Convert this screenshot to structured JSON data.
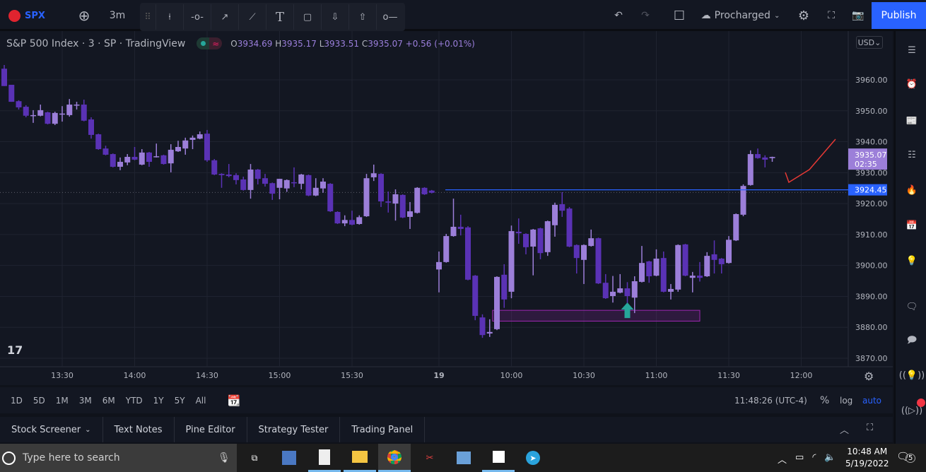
{
  "header": {
    "symbol": "SPX",
    "interval": "3m",
    "layout_name": "Procharged",
    "publish_label": "Publish",
    "drawing_tools": [
      "vertical-line",
      "horizontal-ray",
      "trend-arrow",
      "trend-line",
      "text",
      "rectangle",
      "arrow-down",
      "arrow-up",
      "horizontal-ray-short"
    ]
  },
  "legend": {
    "title": "S&P 500 Index · 3 · SP · TradingView",
    "open_label": "O",
    "open": "3934.69",
    "high_label": "H",
    "high": "3935.17",
    "low_label": "L",
    "low": "3933.51",
    "close_label": "C",
    "close": "3935.07",
    "change": "+0.56 (+0.01%)"
  },
  "price_scale": {
    "currency": "USD",
    "last_price": "3935.07",
    "countdown": "02:35",
    "hline_price": "3924.45"
  },
  "colors": {
    "up": "#9c7fd9",
    "down": "#5a32b5",
    "hline": "#2962ff",
    "box": "#9c27b0",
    "arrow": "#26a69a",
    "drawing": "#e53935",
    "accent": "#2962ff"
  },
  "chart_data": {
    "type": "candlestick",
    "ylim": [
      3865,
      3972
    ],
    "y_ticks": [
      3870,
      3880,
      3890,
      3900,
      3910,
      3920,
      3930,
      3940,
      3950,
      3960
    ],
    "x_ticks": [
      {
        "label": "13:30",
        "bar": 8
      },
      {
        "label": "14:00",
        "bar": 18
      },
      {
        "label": "14:30",
        "bar": 28
      },
      {
        "label": "15:00",
        "bar": 38
      },
      {
        "label": "15:30",
        "bar": 48
      },
      {
        "label": "19",
        "bar": 60
      },
      {
        "label": "10:00",
        "bar": 70
      },
      {
        "label": "10:30",
        "bar": 80
      },
      {
        "label": "11:00",
        "bar": 90
      },
      {
        "label": "11:30",
        "bar": 100
      },
      {
        "label": "12:00",
        "bar": 110
      }
    ],
    "candles_ohlc": [
      [
        3963.6,
        3964.8,
        3958,
        3958
      ],
      [
        3958.4,
        3958.4,
        3952.9,
        3952.9
      ],
      [
        3953.1,
        3953.4,
        3950.4,
        3951.1
      ],
      [
        3951.3,
        3951.8,
        3947.9,
        3948.4
      ],
      [
        3948.6,
        3950.2,
        3946.1,
        3948.6
      ],
      [
        3948.4,
        3952,
        3948.2,
        3950.2
      ],
      [
        3949.5,
        3949.7,
        3945.6,
        3945.8
      ],
      [
        3945.8,
        3949.7,
        3945.4,
        3949.3
      ],
      [
        3949,
        3951.5,
        3946.5,
        3949.1
      ],
      [
        3948.6,
        3953.8,
        3948.1,
        3952
      ],
      [
        3951.8,
        3952.9,
        3950.4,
        3952
      ],
      [
        3952,
        3953.6,
        3946.6,
        3946.8
      ],
      [
        3947.2,
        3947.9,
        3941,
        3942.2
      ],
      [
        3942.4,
        3942.6,
        3937.4,
        3937.6
      ],
      [
        3937.8,
        3938.7,
        3935.6,
        3935.8
      ],
      [
        3936,
        3936.2,
        3931.7,
        3931.9
      ],
      [
        3931.9,
        3934.9,
        3930.8,
        3933.5
      ],
      [
        3933.3,
        3936,
        3932.4,
        3935.1
      ],
      [
        3935.1,
        3938.3,
        3934,
        3934.2
      ],
      [
        3932.6,
        3937.6,
        3932.4,
        3936.5
      ],
      [
        3936.5,
        3936.7,
        3931.9,
        3933.5
      ],
      [
        3935.1,
        3939.4,
        3934.9,
        3935.3
      ],
      [
        3935.6,
        3935.8,
        3932.6,
        3932.8
      ],
      [
        3933,
        3939.2,
        3930.1,
        3937.4
      ],
      [
        3936.9,
        3940.3,
        3936.7,
        3938.3
      ],
      [
        3937.8,
        3941.3,
        3935.8,
        3940.4
      ],
      [
        3940.6,
        3942,
        3937.6,
        3941.3
      ],
      [
        3941,
        3943.3,
        3940.8,
        3942.4
      ],
      [
        3942.6,
        3943.8,
        3933.5,
        3934
      ],
      [
        3934,
        3934.4,
        3929.2,
        3929.4
      ],
      [
        3929.6,
        3929.8,
        3925.1,
        3929.2
      ],
      [
        3929.4,
        3932.8,
        3928.5,
        3928.9
      ],
      [
        3929.2,
        3929.8,
        3926.2,
        3927.6
      ],
      [
        3927.8,
        3928.7,
        3924.2,
        3924.4
      ],
      [
        3924.4,
        3932.8,
        3921.6,
        3931
      ],
      [
        3931,
        3931.2,
        3926.2,
        3928
      ],
      [
        3928.2,
        3929.6,
        3925.5,
        3926.4
      ],
      [
        3926.6,
        3926.8,
        3921.2,
        3923.2
      ],
      [
        3925.1,
        3928,
        3921.4,
        3928
      ],
      [
        3924.9,
        3927.8,
        3923.8,
        3927.6
      ],
      [
        3926.9,
        3931.7,
        3925.3,
        3926.6
      ],
      [
        3926.4,
        3929.6,
        3924.6,
        3929.4
      ],
      [
        3929.2,
        3929.4,
        3922.4,
        3922.6
      ],
      [
        3922.6,
        3928.2,
        3922.4,
        3925.1
      ],
      [
        3924.9,
        3928.2,
        3923.5,
        3927.1
      ],
      [
        3926.4,
        3926.6,
        3917.3,
        3917.5
      ],
      [
        3917.3,
        3917.5,
        3913.4,
        3913.6
      ],
      [
        3913.6,
        3916.2,
        3912.7,
        3914.7
      ],
      [
        3914.7,
        3917.7,
        3913,
        3913.2
      ],
      [
        3913.4,
        3916.2,
        3913.2,
        3915.6
      ],
      [
        3915.9,
        3929.6,
        3915.7,
        3928.2
      ],
      [
        3928.5,
        3932.6,
        3927.3,
        3929.8
      ],
      [
        3929.6,
        3929.8,
        3918.9,
        3920.7
      ],
      [
        3920.7,
        3923.9,
        3917.1,
        3920.3
      ],
      [
        3920,
        3924.6,
        3914.5,
        3923
      ],
      [
        3922.8,
        3923,
        3915.3,
        3915.5
      ],
      [
        3915.7,
        3920.5,
        3911.8,
        3917.5
      ],
      [
        3917,
        3925.3,
        3916.8,
        3925.1
      ],
      [
        3925.1,
        3925.3,
        3922.8,
        3923
      ],
      [
        3924.2,
        3924.4,
        3923.3,
        3923.5
      ],
      [
        3898.7,
        3904.5,
        3891.3,
        3901.1
      ],
      [
        3901.1,
        3910.2,
        3900.9,
        3909.5
      ],
      [
        3909.5,
        3921.6,
        3909.3,
        3912.5
      ],
      [
        3912.5,
        3916.4,
        3909.7,
        3911.8
      ],
      [
        3912.3,
        3912.7,
        3895.2,
        3895.4
      ],
      [
        3896.7,
        3896.9,
        3882.3,
        3883.7
      ],
      [
        3883.2,
        3884.2,
        3876.6,
        3877.5
      ],
      [
        3878,
        3882.6,
        3876.9,
        3878.5
      ],
      [
        3879.4,
        3896.5,
        3879.1,
        3896.3
      ],
      [
        3897,
        3900.4,
        3886.3,
        3889
      ],
      [
        3891.5,
        3912.9,
        3889.4,
        3911.1
      ],
      [
        3910.9,
        3915.2,
        3907,
        3910.4
      ],
      [
        3910.2,
        3910.4,
        3903.6,
        3905.9
      ],
      [
        3906.1,
        3911.8,
        3896.8,
        3911.6
      ],
      [
        3912,
        3912.2,
        3902,
        3904
      ],
      [
        3904.3,
        3914.5,
        3903.1,
        3914.3
      ],
      [
        3913,
        3920.3,
        3909.3,
        3919.6
      ],
      [
        3919.8,
        3923.7,
        3915.7,
        3917.7
      ],
      [
        3918.4,
        3918.9,
        3905.9,
        3906.1
      ],
      [
        3906.6,
        3906.8,
        3897.4,
        3902.4
      ],
      [
        3901.8,
        3906.8,
        3894,
        3906.6
      ],
      [
        3906.3,
        3911.6,
        3906.1,
        3908.8
      ],
      [
        3908.8,
        3909,
        3894,
        3894.2
      ],
      [
        3894.4,
        3897.2,
        3889.2,
        3889.4
      ],
      [
        3890.1,
        3896.6,
        3888,
        3891.5
      ],
      [
        3891.2,
        3897.2,
        3891,
        3892.6
      ],
      [
        3892.6,
        3894.6,
        3885.3,
        3890.1
      ],
      [
        3889.6,
        3896.5,
        3884.6,
        3894.9
      ],
      [
        3894.7,
        3906.3,
        3894.5,
        3900.8
      ],
      [
        3901.3,
        3901.5,
        3894.4,
        3896.5
      ],
      [
        3896.7,
        3905.2,
        3896.5,
        3902.2
      ],
      [
        3902.4,
        3904.5,
        3891.3,
        3891.5
      ],
      [
        3891.5,
        3894,
        3889,
        3892.4
      ],
      [
        3892.2,
        3906.8,
        3891.5,
        3906.6
      ],
      [
        3906.8,
        3907,
        3896.5,
        3896.7
      ],
      [
        3896,
        3897.9,
        3891.3,
        3896.7
      ],
      [
        3896.7,
        3901.1,
        3894.8,
        3896
      ],
      [
        3896.5,
        3904.3,
        3896.3,
        3903.1
      ],
      [
        3903.6,
        3908.1,
        3897.4,
        3901.8
      ],
      [
        3902.2,
        3902.4,
        3897.4,
        3900.4
      ],
      [
        3900.8,
        3909.5,
        3900.6,
        3908.3
      ],
      [
        3908.1,
        3916.8,
        3907.9,
        3916.6
      ],
      [
        3916.4,
        3926.2,
        3915.9,
        3925.7
      ],
      [
        3926,
        3937.2,
        3925.8,
        3936
      ],
      [
        3936,
        3937.8,
        3934.5,
        3934.7
      ],
      [
        3934.9,
        3935.6,
        3931.7,
        3934.2
      ],
      [
        3934.69,
        3935.17,
        3933.51,
        3935.07
      ]
    ],
    "prev_close_line": 3923.6,
    "horizontal_line": 3924.45,
    "rectangle": {
      "bar_from": 67.4,
      "bar_to": 96,
      "price_top": 3885.5,
      "price_bottom": 3882
    },
    "arrow_up": {
      "bar": 86,
      "price": 3883
    },
    "grid": true
  },
  "periods": [
    "1D",
    "5D",
    "1M",
    "3M",
    "6M",
    "YTD",
    "1Y",
    "5Y",
    "All"
  ],
  "status": {
    "clock": "11:48:26 (UTC-4)",
    "percent": "%",
    "log": "log",
    "auto": "auto"
  },
  "bottom_tabs": [
    "Stock Screener",
    "Text Notes",
    "Pine Editor",
    "Strategy Tester",
    "Trading Panel"
  ],
  "right_sidebar": [
    "watchlist-icon",
    "alarm-clock-icon",
    "news-icon",
    "hotlist-icon",
    "fire-icon",
    "calendar-icon",
    "ideas-lightbulb-icon",
    "chats-icon",
    "chat-icon",
    "ideas-stream-icon",
    "streams-icon"
  ],
  "taskbar": {
    "search_placeholder": "Type here to search",
    "time": "10:48 AM",
    "date": "5/19/2022",
    "notifications": "5"
  }
}
